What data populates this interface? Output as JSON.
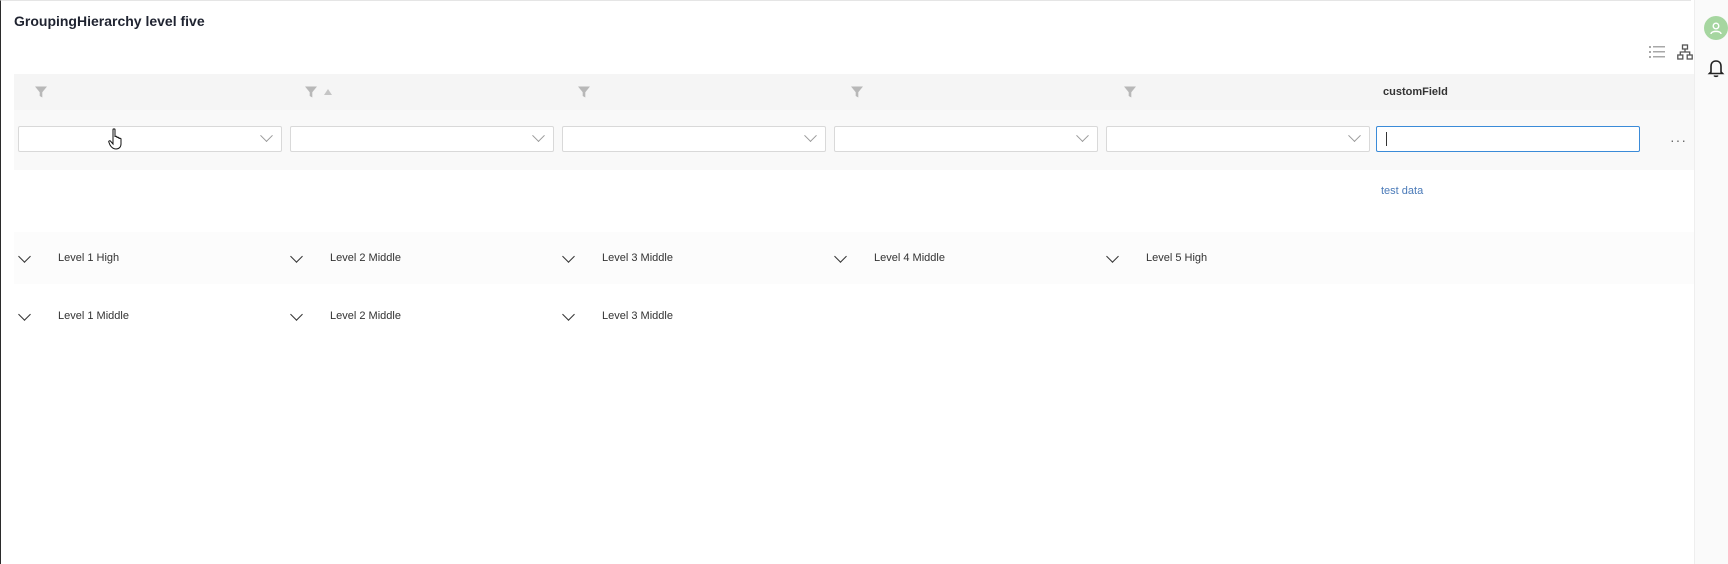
{
  "page": {
    "title": "GroupingHierarchy level five"
  },
  "toolbar": {
    "list_view_icon": "list-icon",
    "hierarchy_view_icon": "hierarchy-icon"
  },
  "rail": {
    "avatar_icon": "user-icon",
    "notifications_icon": "bell-icon"
  },
  "header": {
    "columns": [
      {
        "title": "",
        "filter_icon": "filter-icon"
      },
      {
        "title": "",
        "filter_icon": "filter-icon",
        "sort": "ascending"
      },
      {
        "title": "",
        "filter_icon": "filter-icon"
      },
      {
        "title": "",
        "filter_icon": "filter-icon"
      },
      {
        "title": "",
        "filter_icon": "filter-icon"
      },
      {
        "title": "customField"
      }
    ]
  },
  "filters": {
    "selects": [
      "",
      "",
      "",
      "",
      ""
    ],
    "text_value": ""
  },
  "more_label": "···",
  "summary": {
    "test_data": "test data"
  },
  "groups": [
    {
      "labels": [
        "Level 1 High",
        "Level 2 Middle",
        "Level 3 Middle",
        "Level 4 Middle",
        "Level 5 High"
      ]
    },
    {
      "labels": [
        "Level 1 Middle",
        "Level 2 Middle",
        "Level 3 Middle"
      ]
    }
  ],
  "colors": {
    "accent": "#3b8bd8",
    "link": "#4a7ab8",
    "avatar": "#a6d6a0"
  }
}
